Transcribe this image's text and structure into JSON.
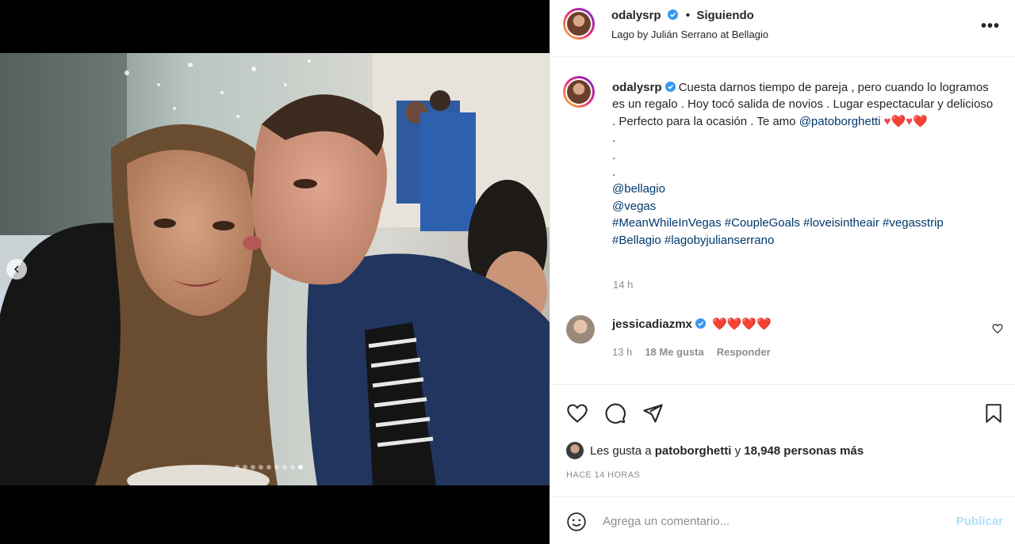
{
  "post": {
    "author": "odalysrp",
    "separator": "•",
    "follow_status": "Siguiendo",
    "location": "Lago by Julián Serrano at Bellagio",
    "more_label": "•••"
  },
  "caption": {
    "username": "odalysrp",
    "text_1": "Cuesta darnos tiempo de pareja , pero cuando lo logramos es un regalo . Hoy tocó salida de novios . Lugar espectacular y delicioso . Perfecto para la ocasión . Te amo",
    "mention": "@patoborghetti",
    "emoji": "♥❤️♥❤️",
    "dot_1": ".",
    "dot_2": ".",
    "dot_3": ".",
    "tags_line_1": "@bellagio",
    "tags_line_2": "@vegas",
    "tags_line_3": "#MeanWhileInVegas #CoupleGoals #loveisintheair #vegasstrip",
    "tags_line_4": "#Bellagio #lagobyjulianserrano",
    "time": "14 h"
  },
  "comments": [
    {
      "username": "jessicadiazmx",
      "text": "❤️❤️❤️❤️",
      "time": "13 h",
      "likes": "18 Me gusta",
      "reply": "Responder"
    }
  ],
  "likes": {
    "prefix": "Les gusta a",
    "user": "patoborghetti",
    "middle": "y",
    "count": "18,948 personas más"
  },
  "timestamp": "HACE 14 HORAS",
  "add_comment": {
    "placeholder": "Agrega un comentario...",
    "post_label": "Publicar"
  },
  "carousel": {
    "total": 9,
    "active_index": 8
  },
  "colors": {
    "link": "#00376b",
    "verified": "#3897f0",
    "muted": "#8e8e8e",
    "post_button": "#b2dffc"
  }
}
